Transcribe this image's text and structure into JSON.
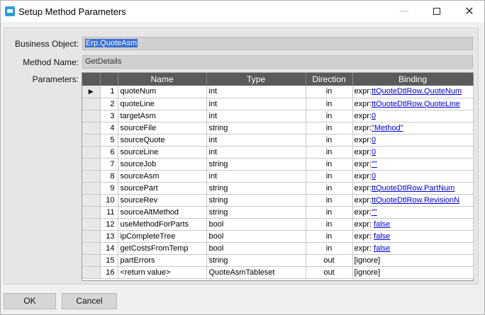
{
  "window": {
    "title": "Setup Method Parameters",
    "minimize_glyph": "—",
    "close_glyph": "✕"
  },
  "form": {
    "business_object_label": "Business Object:",
    "business_object_value": "Erp.QuoteAsm",
    "method_name_label": "Method Name:",
    "method_name_value": "GetDetails",
    "parameters_label": "Parameters:"
  },
  "grid": {
    "columns": {
      "name": "Name",
      "type": "Type",
      "direction": "Direction",
      "binding": "Binding"
    },
    "current_row_glyph": "▶",
    "rows": [
      {
        "num": "1",
        "name": "quoteNum",
        "type": "int",
        "direction": "in",
        "prefix": "expr:",
        "value": "ttQuoteDtlRow.QuoteNum"
      },
      {
        "num": "2",
        "name": "quoteLine",
        "type": "int",
        "direction": "in",
        "prefix": "expr:",
        "value": "ttQuoteDtlRow.QuoteLine"
      },
      {
        "num": "3",
        "name": "targetAsm",
        "type": "int",
        "direction": "in",
        "prefix": "expr:",
        "value": "0"
      },
      {
        "num": "4",
        "name": "sourceFile",
        "type": "string",
        "direction": "in",
        "prefix": "expr:",
        "value": "\"Method\""
      },
      {
        "num": "5",
        "name": "sourceQuote",
        "type": "int",
        "direction": "in",
        "prefix": "expr:",
        "value": "0"
      },
      {
        "num": "6",
        "name": "sourceLine",
        "type": "int",
        "direction": "in",
        "prefix": "expr:",
        "value": "0"
      },
      {
        "num": "7",
        "name": "sourceJob",
        "type": "string",
        "direction": "in",
        "prefix": "expr:",
        "value": "\"\""
      },
      {
        "num": "8",
        "name": "sourceAsm",
        "type": "int",
        "direction": "in",
        "prefix": "expr:",
        "value": "0"
      },
      {
        "num": "9",
        "name": "sourcePart",
        "type": "string",
        "direction": "in",
        "prefix": "expr:",
        "value": "ttQuoteDtlRow.PartNum"
      },
      {
        "num": "10",
        "name": "sourceRev",
        "type": "string",
        "direction": "in",
        "prefix": "expr:",
        "value": "ttQuoteDtlRow.RevisionN"
      },
      {
        "num": "11",
        "name": "sourceAltMethod",
        "type": "string",
        "direction": "in",
        "prefix": "expr:",
        "value": "\"\""
      },
      {
        "num": "12",
        "name": "useMethodForParts",
        "type": "bool",
        "direction": "in",
        "prefix": "expr: ",
        "value": "false"
      },
      {
        "num": "13",
        "name": "ipCompleteTree",
        "type": "bool",
        "direction": "in",
        "prefix": "expr: ",
        "value": "false"
      },
      {
        "num": "14",
        "name": "getCostsFromTemp",
        "type": "bool",
        "direction": "in",
        "prefix": "expr: ",
        "value": "false"
      },
      {
        "num": "15",
        "name": "partErrors",
        "type": "string",
        "direction": "out",
        "prefix": "[ignore]",
        "value": ""
      },
      {
        "num": "16",
        "name": "<return value>",
        "type": "QuoteAsmTableset",
        "direction": "out",
        "prefix": "[ignore]",
        "value": ""
      }
    ]
  },
  "buttons": {
    "ok": "OK",
    "cancel": "Cancel"
  }
}
